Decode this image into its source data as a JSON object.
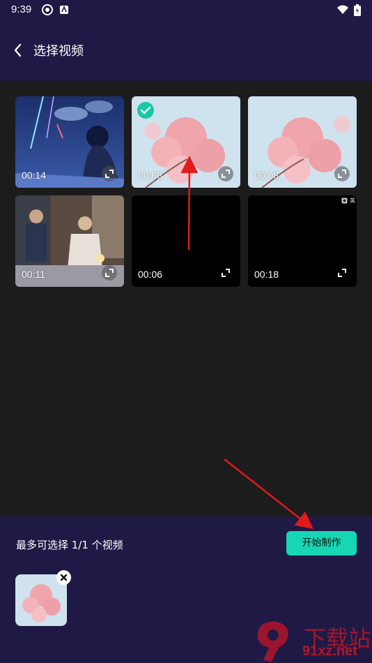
{
  "status": {
    "time": "9:39"
  },
  "header": {
    "title": "选择视频"
  },
  "grid": {
    "tiles": [
      {
        "duration": "00:14",
        "selected": false
      },
      {
        "duration": "00:08",
        "selected": true
      },
      {
        "duration": "00:08",
        "selected": false
      },
      {
        "duration": "00:11",
        "selected": false
      },
      {
        "duration": "00:06",
        "selected": false
      },
      {
        "duration": "00:18",
        "selected": false,
        "badge": "美"
      }
    ]
  },
  "footer": {
    "limit_text": "最多可选择 1/1 个视频",
    "start_button": "开始制作"
  },
  "watermark": {
    "text": "91xz.net",
    "logo": "下载站"
  },
  "colors": {
    "accent": "#17d6b4",
    "header_bg": "#1f1a45",
    "content_bg": "#1c1c1c",
    "annotation_arrow": "#e01b1b"
  }
}
